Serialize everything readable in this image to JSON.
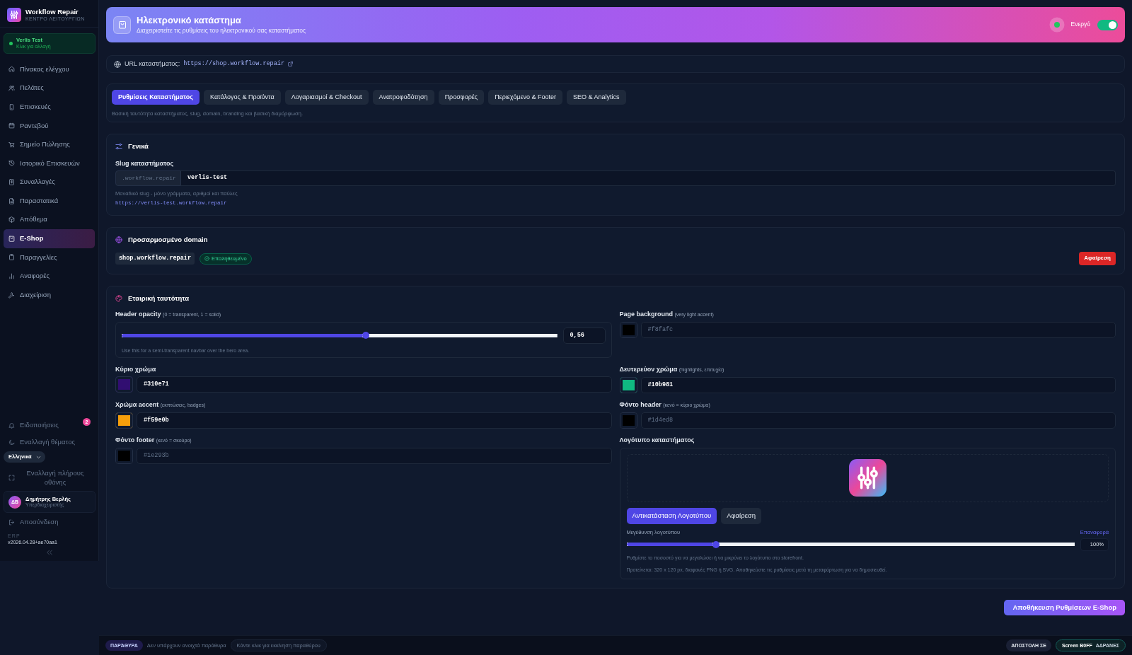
{
  "sidebar": {
    "brand_title": "Workflow Repair",
    "brand_subtitle": "ΚΕΝΤΡΟ ΛΕΙΤΟΥΡΓΙΩΝ",
    "workspace": {
      "name": "Verlis Test",
      "hint": "Κλικ για αλλαγή"
    },
    "items": [
      {
        "label": "Πίνακας ελέγχου",
        "selected": false
      },
      {
        "label": "Πελάτες",
        "selected": false
      },
      {
        "label": "Επισκευές",
        "selected": false
      },
      {
        "label": "Ραντεβού",
        "selected": false
      },
      {
        "label": "Σημείο Πώλησης",
        "selected": false
      },
      {
        "label": "Ιστορικό Επισκευών",
        "selected": false
      },
      {
        "label": "Συναλλαγές",
        "selected": false
      },
      {
        "label": "Παραστατικά",
        "selected": false
      },
      {
        "label": "Απόθεμα",
        "selected": false
      },
      {
        "label": "E-Shop",
        "selected": true
      },
      {
        "label": "Παραγγελίες",
        "selected": false
      },
      {
        "label": "Αναφορές",
        "selected": false
      },
      {
        "label": "Διαχείριση",
        "selected": false
      }
    ],
    "notifications": {
      "label": "Ειδοποιήσεις",
      "badge": "2"
    },
    "theme_toggle": "Εναλλαγή θέματος",
    "language": "Ελληνικά",
    "fullscreen_toggle": "Εναλλαγή πλήρους οθόνης",
    "user": {
      "initials": "ΔΒ",
      "name": "Δημήτρης Βερλής",
      "role": "Υπερδιαχειριστής"
    },
    "logout": "Αποσύνδεση",
    "version_label": "ERP",
    "version": "v2026.04.28+ae70aa1"
  },
  "header": {
    "title": "Ηλεκτρονικό κατάστημα",
    "subtitle": "Διαχειριστείτε τις ρυθμίσεις του ηλεκτρονικού σας καταστήματος",
    "status_label": "Ενεργό",
    "active": true
  },
  "store_url": {
    "label": "URL καταστήματος:",
    "url": "https://shop.workflow.repair"
  },
  "tabs": [
    {
      "label": "Ρυθμίσεις Καταστήματος",
      "selected": true
    },
    {
      "label": "Κατάλογος & Προϊόντα",
      "selected": false
    },
    {
      "label": "Λογαριασμοί & Checkout",
      "selected": false
    },
    {
      "label": "Ανατροφοδότηση",
      "selected": false
    },
    {
      "label": "Προσφορές",
      "selected": false
    },
    {
      "label": "Περιεχόμενο & Footer",
      "selected": false
    },
    {
      "label": "SEO & Analytics",
      "selected": false
    }
  ],
  "tab_description": "Βασική ταυτότητα καταστήματος, slug, domain, branding και βασική διαμόρφωση.",
  "general": {
    "title": "Γενικά",
    "slug_label": "Slug καταστήματος",
    "slug_suffix": ".workflow.repair",
    "slug_value": "verlis-test",
    "help": "Μοναδικό slug - μόνο γράμματα, αριθμοί και παύλες",
    "preview_url": "https://verlis-test.workflow.repair"
  },
  "custom_domain": {
    "title": "Προσαρμοσμένο domain",
    "domain": "shop.workflow.repair",
    "status": "Επαληθευμένο",
    "verified": true,
    "remove_button": "Αφαίρεση"
  },
  "branding": {
    "title": "Εταιρική ταυτότητα",
    "fields": [
      {
        "kind": "slider",
        "label": "Header opacity",
        "hint": "(0 = transparent, 1 = solid)",
        "level": 0.56,
        "value": "0,56",
        "help": "Use this for a semi-transparent navbar over the hero area."
      },
      {
        "kind": "color",
        "label": "Page background",
        "hint": "(very light accent)",
        "placeholder": "#f8fafc",
        "color": "#000000"
      },
      {
        "kind": "color",
        "label": "Κύριο χρώμα",
        "value": "#310e71",
        "color": "#310e71"
      },
      {
        "kind": "color",
        "label": "Δευτερεύον χρώμα",
        "hint": "(highlights, επιτυχία)",
        "value": "#10b981",
        "color": "#10b981"
      },
      {
        "kind": "color",
        "label": "Χρώμα accent",
        "hint": "(εκπτώσεις, badges)",
        "value": "#f59e0b",
        "color": "#f59e0b"
      },
      {
        "kind": "color",
        "label": "Φόντο header",
        "hint": "(κενό = κύριο χρώμα)",
        "placeholder": "#1d4ed8",
        "color": "#000000"
      },
      {
        "kind": "color",
        "label": "Φόντο footer",
        "hint": "(κενό = σκούρο)",
        "placeholder": "#1e293b",
        "color": "#000000"
      },
      {
        "kind": "logo",
        "label": "Λογότυπο καταστήματος",
        "replace_button": "Αντικατάσταση Λογοτύπου",
        "remove_button": "Αφαίρεση",
        "size_label": "Μεγέθυνση λογοτύπου",
        "reset_link": "Επαναφορά",
        "level": 0.2,
        "value": "100%",
        "help": [
          "Ρυθμίστε το ποσοστό για να μεγαλώσει ή να μικρύνει το λογότυπο στο storefront.",
          "Προτείνεται: 320 x 120 px, διαφανές PNG ή SVG. Αποθηκεύστε τις ρυθμίσεις μετά τη μεταφόρτωση για να δημοσιευθεί."
        ]
      }
    ]
  },
  "save_button": "Αποθήκευση Ρυθμίσεων E-Shop",
  "taskbar": {
    "windows_label": "ΠΑΡΆΘΥΡΑ",
    "empty_text": "Δεν υπάρχουν ανοιχτά παράθυρα",
    "launch_button": "Κάντε κλικ για εκκίνηση παραθύρου",
    "send_to": "ΑΠΟΣΤΟΛΗ ΣΕ",
    "screen": {
      "label": "Screen B0FF",
      "status": "ΑΔΡΑΝΕΣ"
    }
  }
}
